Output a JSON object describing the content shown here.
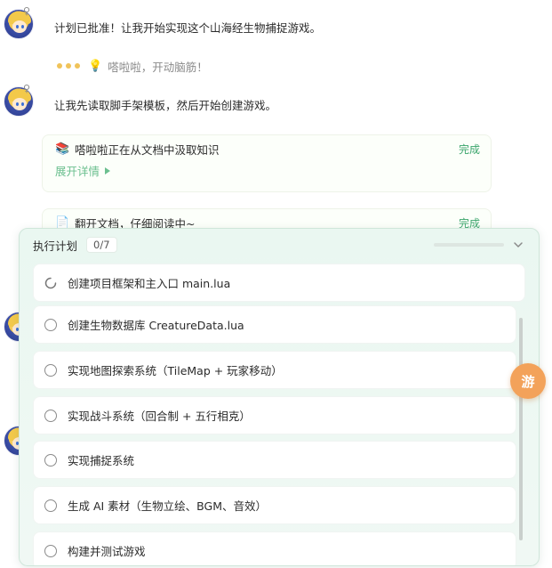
{
  "chat": {
    "msg1": "计划已批准！让我开始实现这个山海经生物捕捉游戏。",
    "thinking": "嗒啦啦，开动脑筋！",
    "msg2": "让我先读取脚手架模板，然后开始创建游戏。",
    "card1": {
      "title": "嗒啦啦正在从文档中汲取知识",
      "status": "完成",
      "expand": "展开详情"
    },
    "card2": {
      "title": "翻开文档，仔细阅读中~",
      "status": "完成"
    }
  },
  "plan": {
    "title": "执行计划",
    "count": "0/7",
    "progress": 0,
    "tasks": [
      {
        "label": "创建项目框架和主入口 main.lua",
        "state": "running"
      },
      {
        "label": "创建生物数据库 CreatureData.lua",
        "state": "pending"
      },
      {
        "label": "实现地图探索系统（TileMap + 玩家移动）",
        "state": "pending"
      },
      {
        "label": "实现战斗系统（回合制 + 五行相克）",
        "state": "pending"
      },
      {
        "label": "实现捕捉系统",
        "state": "pending"
      },
      {
        "label": "生成 AI 素材（生物立绘、BGM、音效）",
        "state": "pending"
      },
      {
        "label": "构建并测试游戏",
        "state": "pending"
      }
    ]
  },
  "fab": {
    "label": "游",
    "color": "#f3a25a"
  },
  "colors": {
    "accent": "#49b07a",
    "done": "#3aa56b",
    "panel_bg": "#eaf7f1"
  }
}
